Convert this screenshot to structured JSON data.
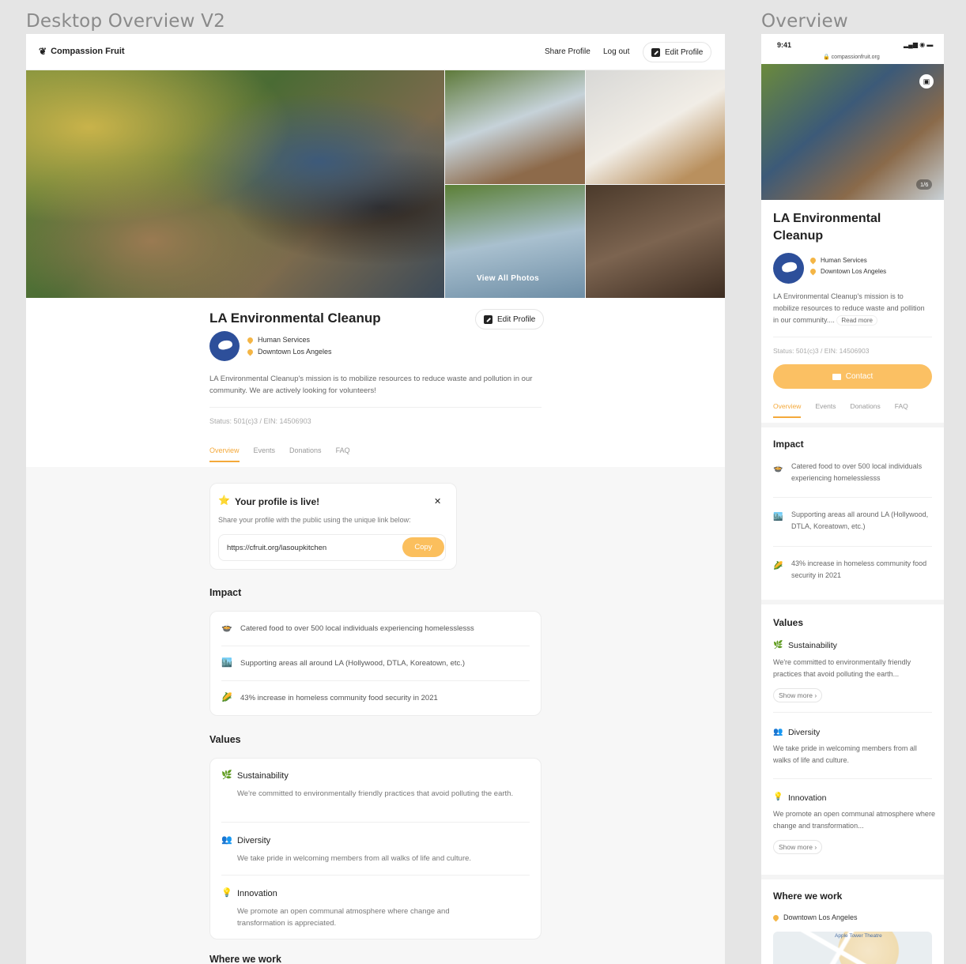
{
  "frames": {
    "desktop_label": "Desktop Overview V2",
    "mobile_label": "Overview"
  },
  "brand": {
    "name": "Compassion Fruit"
  },
  "nav": {
    "share": "Share Profile",
    "logout": "Log out",
    "edit": "Edit Profile"
  },
  "gallery": {
    "view_all": "View All Photos",
    "counter": "1/6"
  },
  "org": {
    "name": "LA Environmental Cleanup",
    "category": "Human Services",
    "location": "Downtown Los Angeles",
    "mission": "LA Environmental Cleanup's mission is to mobilize resources to reduce waste and pollution in our community. We are actively looking for volunteers!",
    "mission_mobile": "LA Environmental Cleanup's mission is to mobilize resources to reduce waste and pollition in our community....",
    "read_more": "Read more",
    "status": "Status: 501(c)3 / EIN: 14506903",
    "edit": "Edit Profile"
  },
  "tabs": [
    "Overview",
    "Events",
    "Donations",
    "FAQ"
  ],
  "live_card": {
    "title": "Your profile is live!",
    "subtitle": "Share your profile with the public using the unique link below:",
    "link": "https://cfruit.org/lasoupkitchen",
    "copy": "Copy",
    "star_icon": "⭐",
    "close_icon": "✕"
  },
  "impact": {
    "heading": "Impact",
    "items": [
      {
        "icon": "🍲",
        "text": "Catered food to over 500 local individuals experiencing homelesslesss"
      },
      {
        "icon": "🏙️",
        "text": "Supporting areas all around LA (Hollywood, DTLA, Koreatown, etc.)"
      },
      {
        "icon": "🌽",
        "text": "43% increase in homeless community food security in 2021"
      }
    ]
  },
  "values": {
    "heading": "Values",
    "items": [
      {
        "icon": "🌿",
        "title": "Sustainability",
        "text": "We're committed to environmentally friendly practices that avoid polluting the earth.",
        "text_mobile": "We're committed to environmentally friendly practices that avoid polluting the earth..."
      },
      {
        "icon": "👥",
        "title": "Diversity",
        "text": "We take pride in welcoming members from all walks of life and culture.",
        "text_mobile": "We take pride in welcoming members from all walks of life and culture."
      },
      {
        "icon": "💡",
        "title": "Innovation",
        "text": "We promote an open communal atmosphere where change and transformation is appreciated.",
        "text_mobile": "We promote an open communal atmosphere where change and transformation..."
      }
    ],
    "show_more": "Show more"
  },
  "where": {
    "heading": "Where we work",
    "location": "Downtown Los Angeles",
    "map_label": "Apple Tower Theatre"
  },
  "mobile": {
    "time": "9:41",
    "url": "compassionfruit.org",
    "contact": "Contact"
  }
}
